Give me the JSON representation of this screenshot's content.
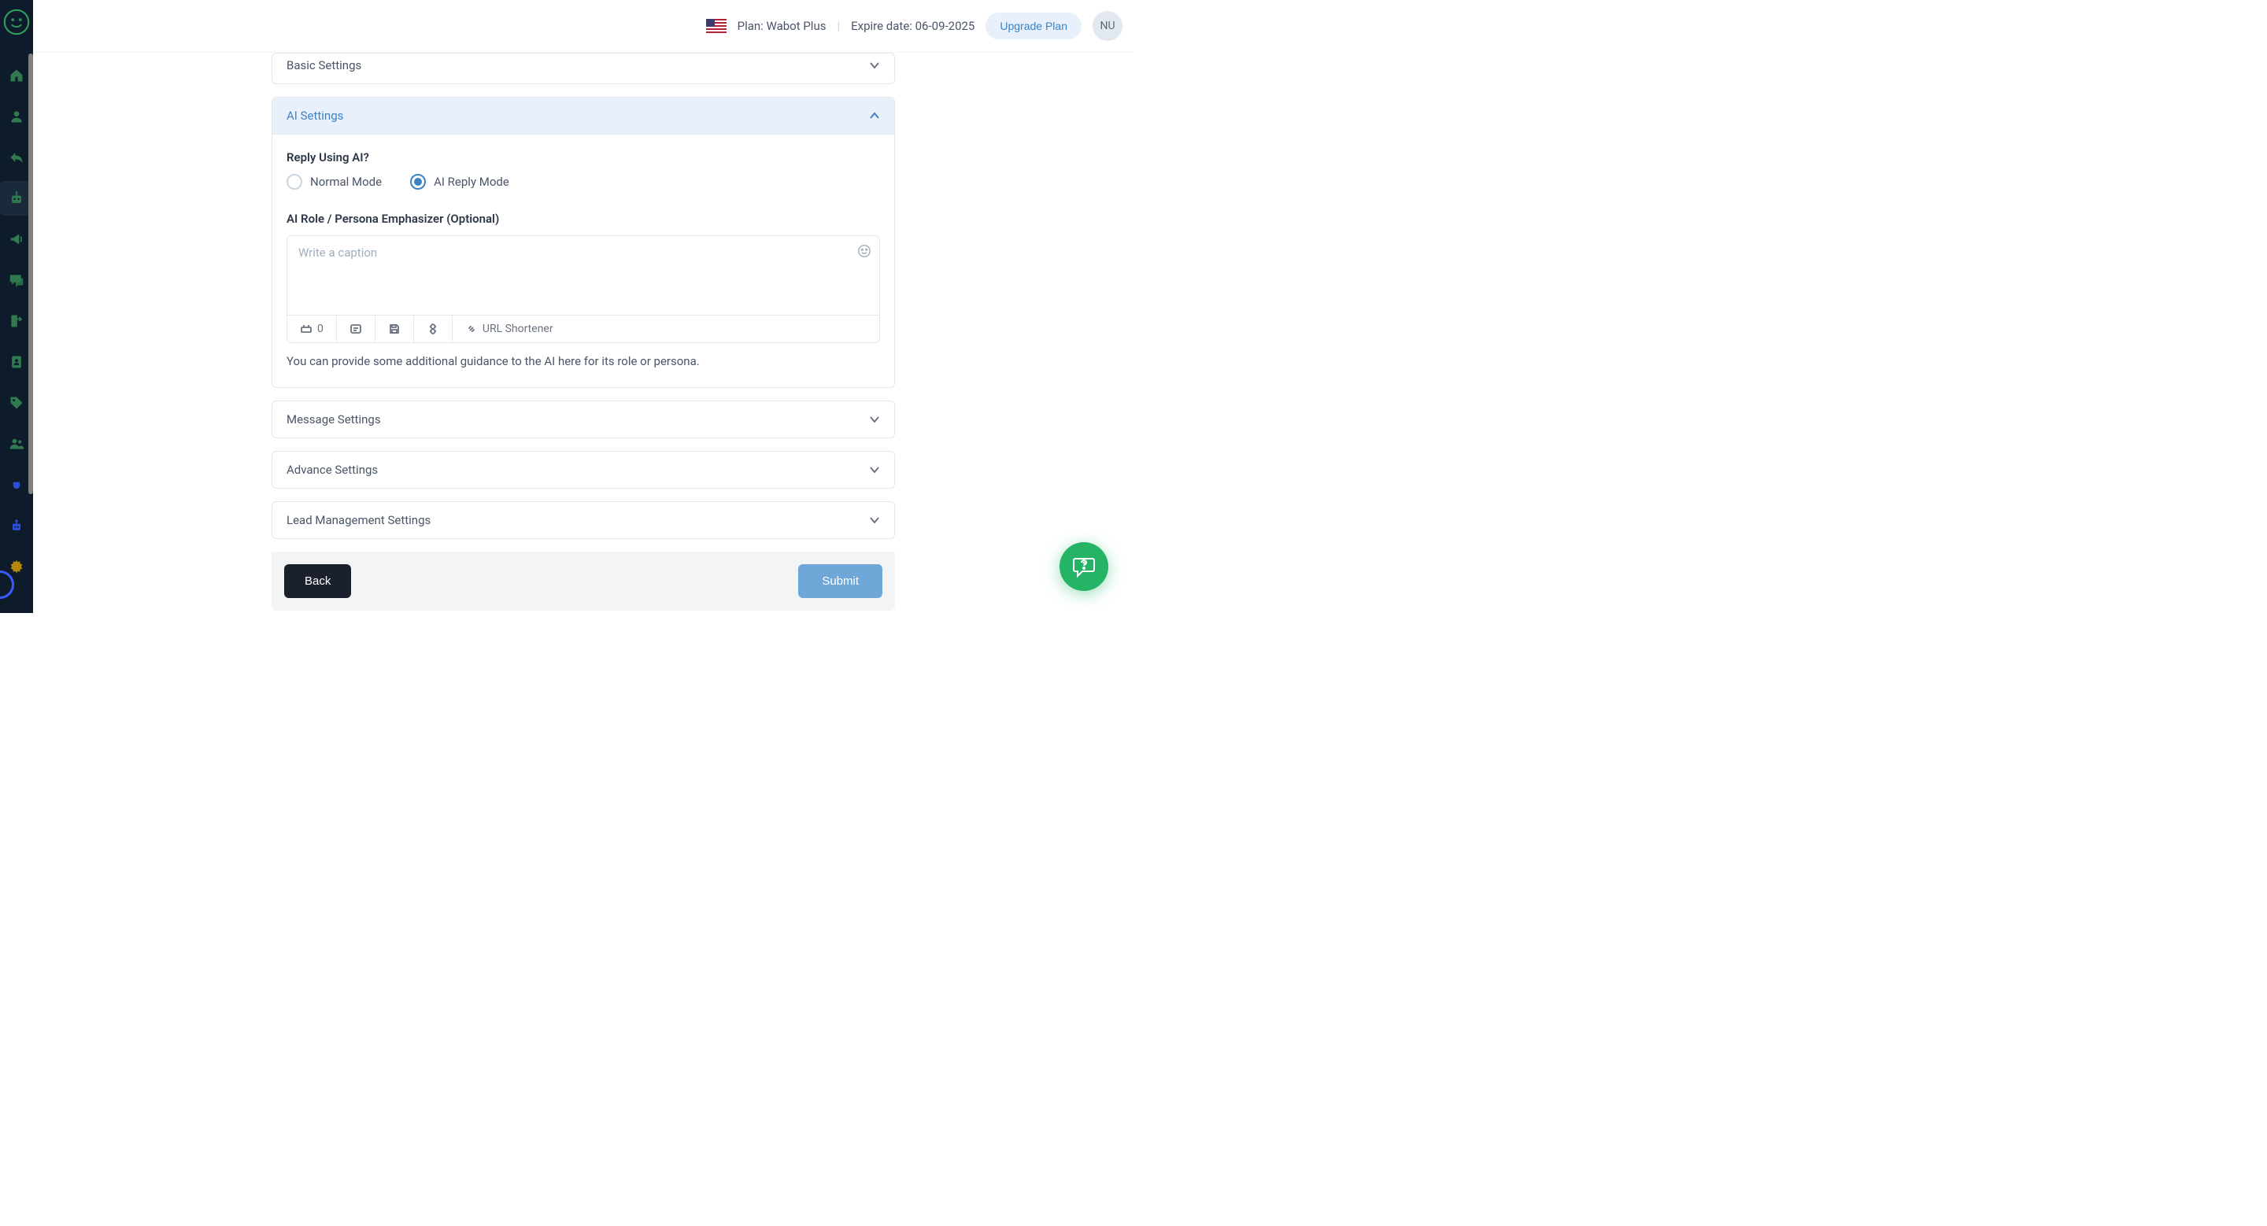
{
  "header": {
    "plan_label": "Plan: Wabot Plus",
    "expire_label": "Expire date: 06-09-2025",
    "upgrade_label": "Upgrade Plan",
    "avatar_initials": "NU"
  },
  "sidebar": {
    "icons": [
      "home-icon",
      "user-icon",
      "reply-icon",
      "robot-icon",
      "megaphone-icon",
      "chat-icon",
      "export-icon",
      "contact-book-icon",
      "tag-icon",
      "users-icon",
      "plug-icon",
      "ai-robot-icon",
      "gear-icon"
    ],
    "active_index": 3
  },
  "accordion": {
    "basic": "Basic Settings",
    "ai": "AI Settings",
    "message": "Message Settings",
    "advance": "Advance Settings",
    "lead": "Lead Management Settings"
  },
  "ai_panel": {
    "reply_using_label": "Reply Using AI?",
    "mode_normal": "Normal Mode",
    "mode_ai": "AI Reply Mode",
    "selected_mode": "ai",
    "persona_label": "AI Role / Persona Emphasizer (Optional)",
    "placeholder": "Write a caption",
    "toolbar_count": "0",
    "url_shortener_label": "URL Shortener",
    "help_text": "You can provide some additional guidance to the AI here for its role or persona."
  },
  "footer": {
    "back": "Back",
    "submit": "Submit"
  }
}
